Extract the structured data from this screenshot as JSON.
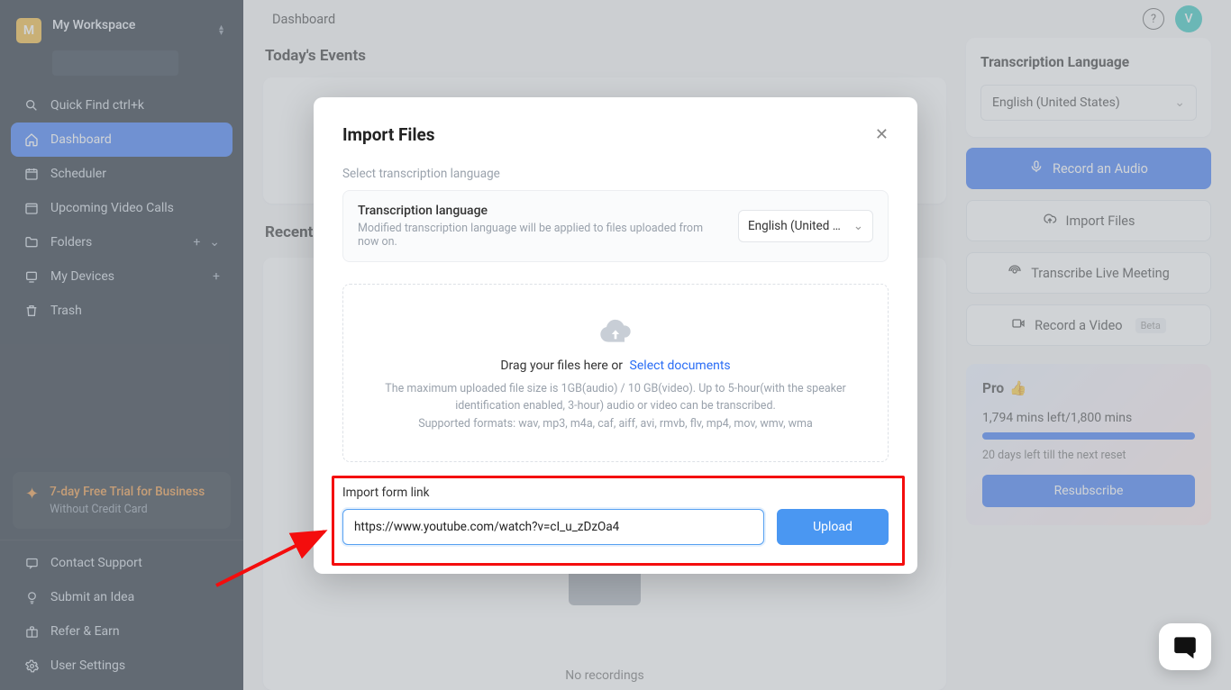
{
  "workspace": {
    "badge_letter": "M",
    "name": "My Workspace"
  },
  "sidebar": {
    "quick_find": "Quick Find ctrl+k",
    "items": {
      "dashboard": "Dashboard",
      "scheduler": "Scheduler",
      "upcoming": "Upcoming Video Calls",
      "folders": "Folders",
      "devices": "My Devices",
      "trash": "Trash"
    },
    "trial": {
      "title": "7-day Free Trial for Business",
      "subtitle": "Without Credit Card"
    },
    "footer": {
      "contact": "Contact Support",
      "idea": "Submit an Idea",
      "refer": "Refer & Earn",
      "settings": "User Settings"
    }
  },
  "topbar": {
    "title": "Dashboard",
    "avatar_letter": "V"
  },
  "sections": {
    "events_title": "Today's Events",
    "recent_title": "Recent",
    "no_recordings": "No recordings"
  },
  "right_panel": {
    "lang_heading": "Transcription Language",
    "lang_value": "English (United States)",
    "record_audio": "Record an Audio",
    "import_files": "Import Files",
    "live_meeting": "Transcribe Live Meeting",
    "record_video": "Record a Video",
    "beta_label": "Beta"
  },
  "pro": {
    "title": "Pro",
    "mins_text": "1,794 mins left/1,800 mins",
    "note": "20 days left till the next reset",
    "resubscribe": "Resubscribe"
  },
  "modal": {
    "title": "Import Files",
    "select_lang_label": "Select transcription language",
    "lang_row_label": "Transcription language",
    "lang_row_note": "Modified transcription language will be applied to files uploaded from now on.",
    "lang_row_value": "English (United S...",
    "drag_text": "Drag your files here or",
    "select_docs": "Select documents",
    "limit_line1": "The maximum uploaded file size is 1GB(audio) / 10 GB(video). Up to 5-hour(with the speaker identification enabled, 3-hour) audio or video can be transcribed.",
    "limit_line2": "Supported formats: wav, mp3, m4a, caf, aiff, avi, rmvb, flv, mp4, mov, wmv, wma",
    "import_link_label": "Import form link",
    "link_value": "https://www.youtube.com/watch?v=cI_u_zDzOa4",
    "upload_label": "Upload"
  }
}
